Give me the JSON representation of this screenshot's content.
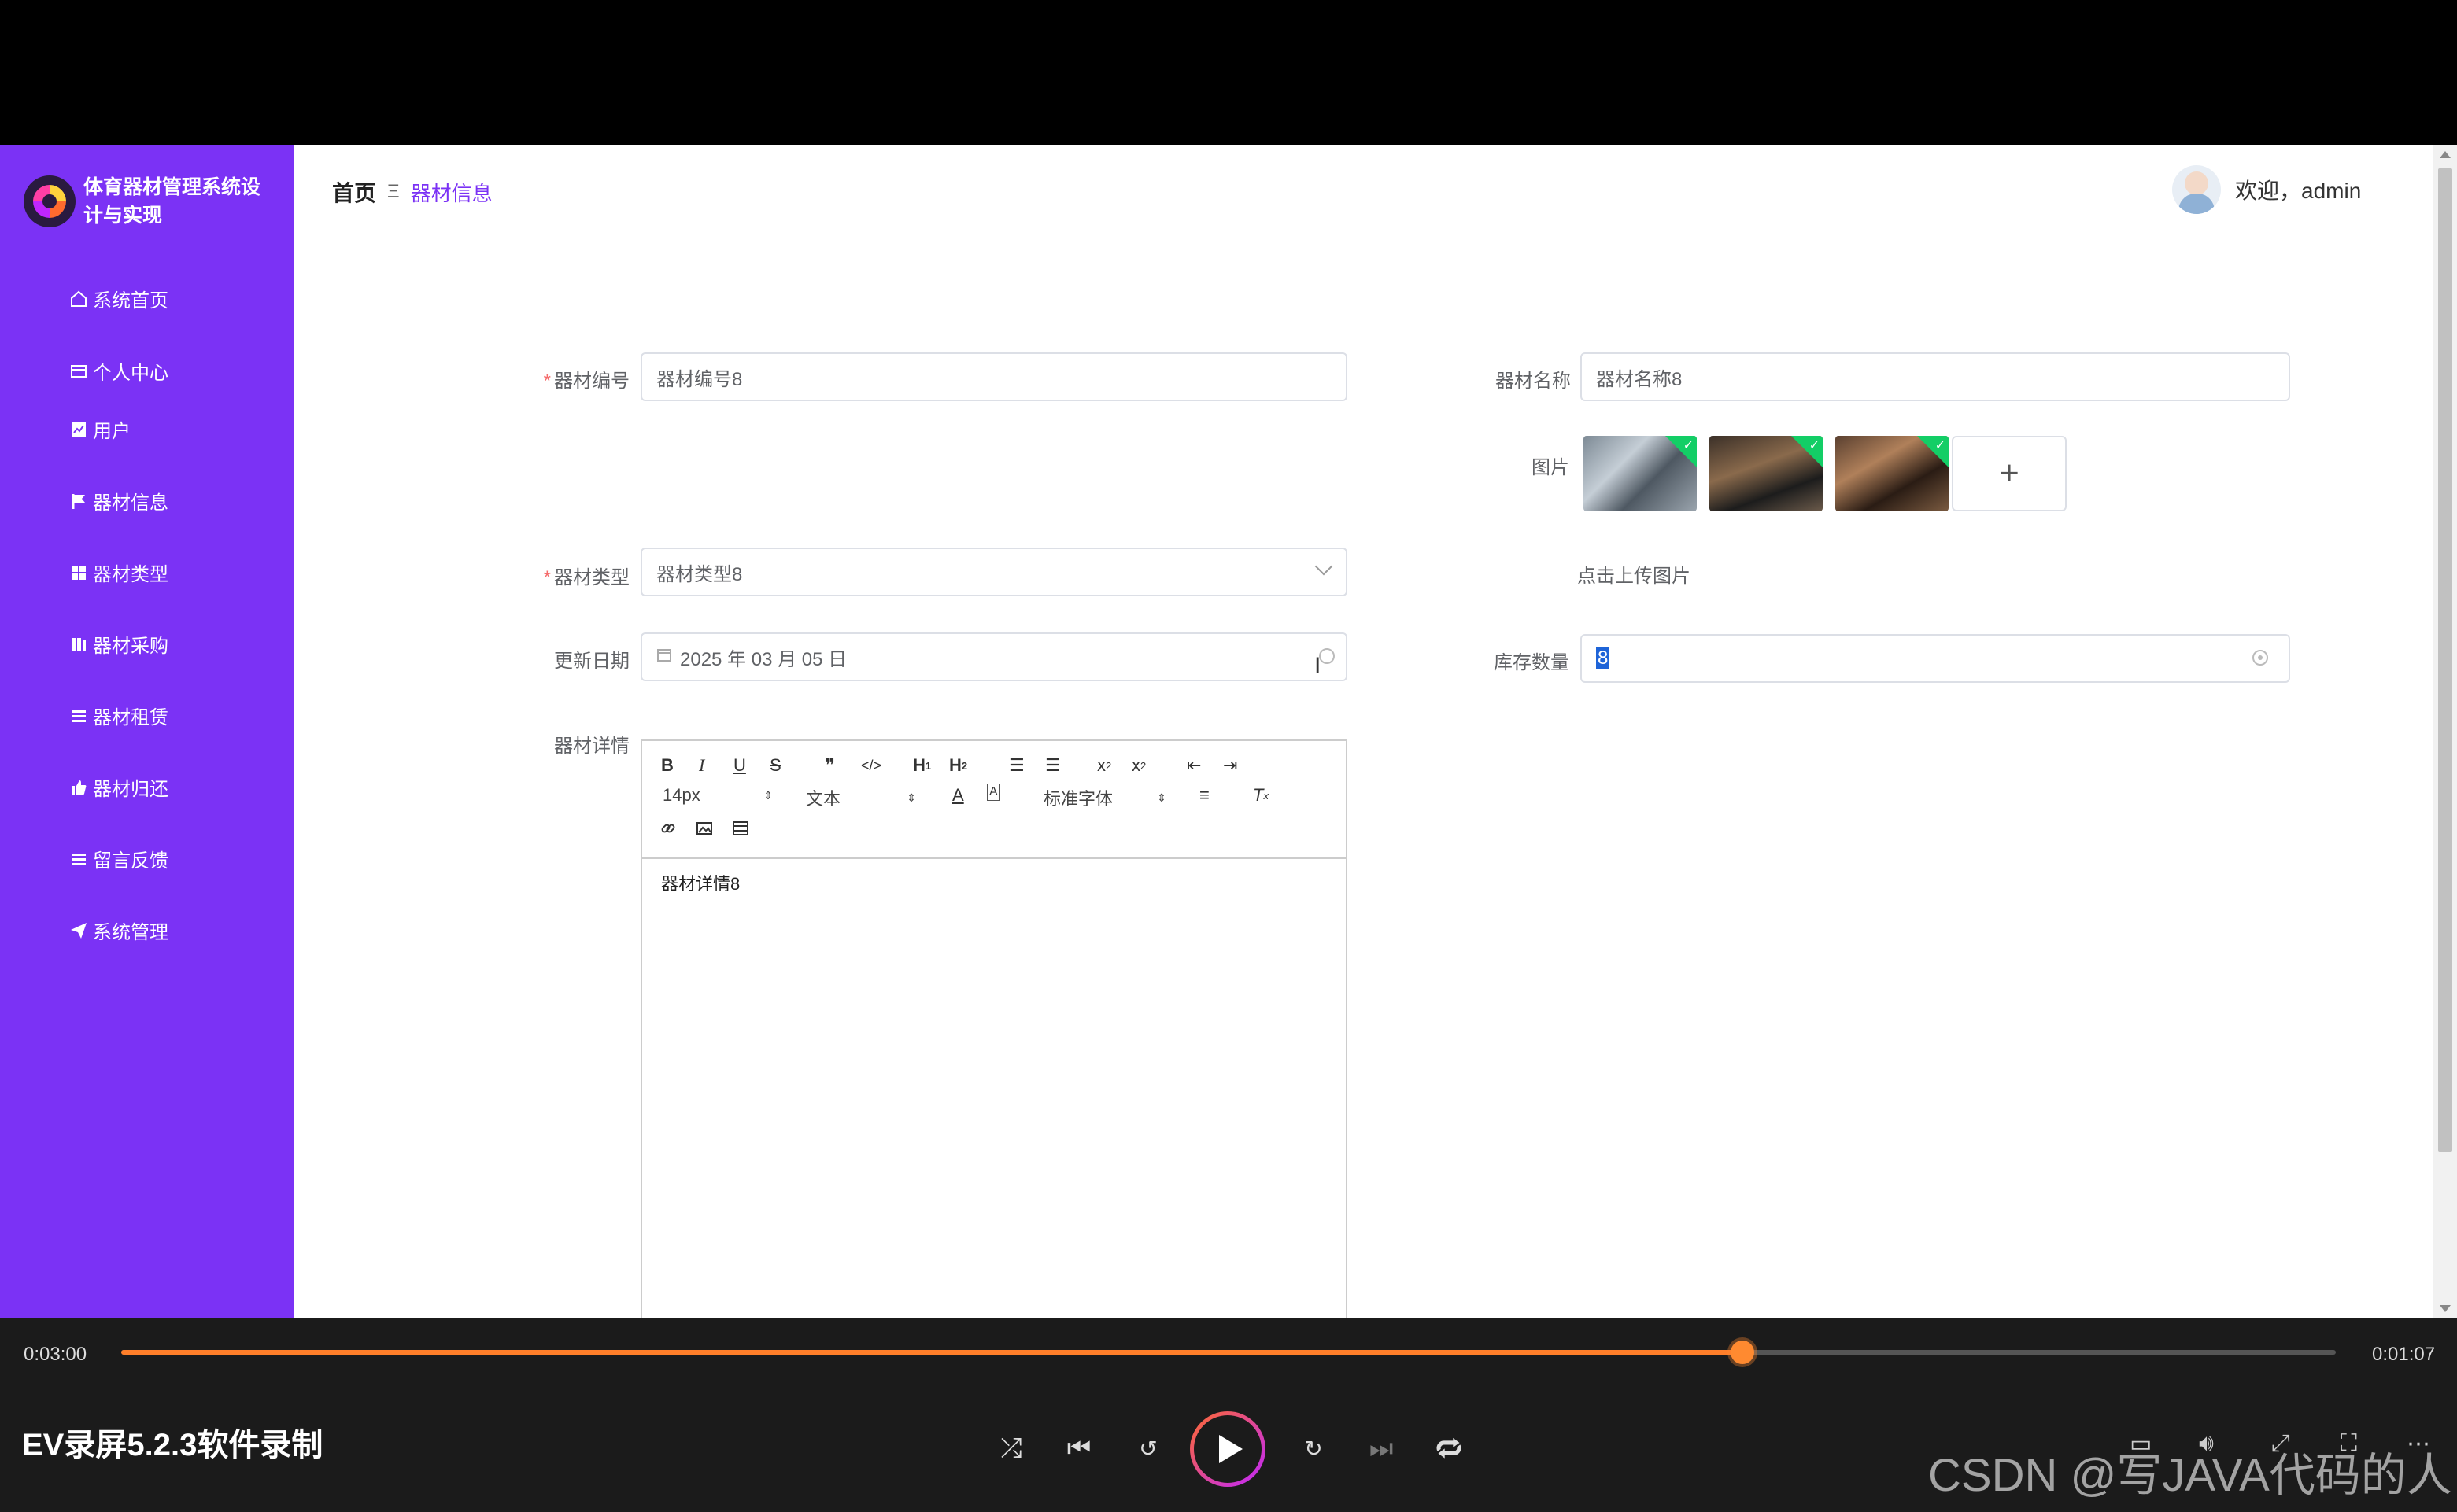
{
  "app": {
    "brand_title": "体育器材管理系统设计与实现",
    "breadcrumb": {
      "home": "首页",
      "separator": "Ξ",
      "current": "器材信息"
    },
    "user": {
      "welcome": "欢迎，admin"
    }
  },
  "sidebar": {
    "items": [
      {
        "label": "系统首页",
        "icon": "home-icon"
      },
      {
        "label": "个人中心",
        "icon": "card-icon"
      },
      {
        "label": "用户",
        "icon": "chart-icon"
      },
      {
        "label": "器材信息",
        "icon": "flag-icon"
      },
      {
        "label": "器材类型",
        "icon": "grid-icon"
      },
      {
        "label": "器材采购",
        "icon": "book-icon"
      },
      {
        "label": "器材租赁",
        "icon": "list-icon"
      },
      {
        "label": "器材归还",
        "icon": "thumb-icon"
      },
      {
        "label": "留言反馈",
        "icon": "list-icon"
      },
      {
        "label": "系统管理",
        "icon": "send-icon"
      }
    ]
  },
  "form": {
    "code": {
      "label": "器材编号",
      "value": "器材编号8",
      "required": true
    },
    "name": {
      "label": "器材名称",
      "value": "器材名称8"
    },
    "images": {
      "label": "图片",
      "upload_hint": "点击上传图片"
    },
    "type": {
      "label": "器材类型",
      "value": "器材类型8",
      "required": true
    },
    "date": {
      "label": "更新日期",
      "value": "2025 年 03 月 05 日"
    },
    "stock": {
      "label": "库存数量",
      "value": "8"
    },
    "detail": {
      "label": "器材详情",
      "content": "器材详情8",
      "font_size": "14px",
      "block_type": "文本",
      "font_family": "标准字体"
    }
  },
  "player": {
    "current_time": "0:03:00",
    "remaining_time": "0:01:07",
    "progress": 0.732,
    "title": "EV录屏5.2.3软件录制",
    "accent": "#ff7f2a"
  },
  "watermark": "CSDN @写JAVA代码的人",
  "colors": {
    "sidebar": "#7b32f5",
    "primary": "#7b32f5",
    "required": "#f56c6c"
  }
}
